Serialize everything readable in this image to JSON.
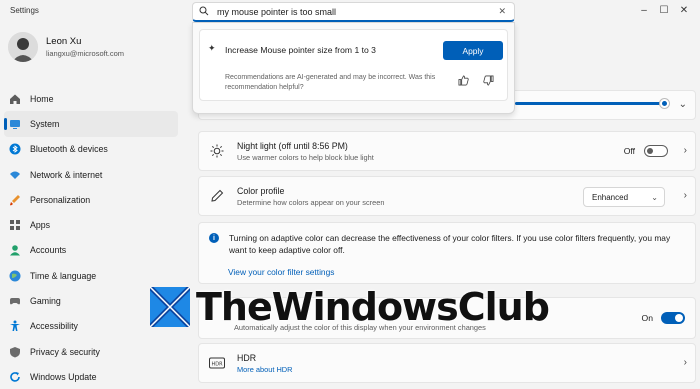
{
  "app": {
    "title": "Settings"
  },
  "profile": {
    "name": "Leon Xu",
    "email": "liangxu@microsoft.com"
  },
  "nav": [
    {
      "label": "Home",
      "icon": "home-icon"
    },
    {
      "label": "System",
      "icon": "system-icon",
      "active": true
    },
    {
      "label": "Bluetooth & devices",
      "icon": "bluetooth-icon"
    },
    {
      "label": "Network & internet",
      "icon": "wifi-icon"
    },
    {
      "label": "Personalization",
      "icon": "brush-icon"
    },
    {
      "label": "Apps",
      "icon": "apps-icon"
    },
    {
      "label": "Accounts",
      "icon": "person-icon"
    },
    {
      "label": "Time & language",
      "icon": "globe-icon"
    },
    {
      "label": "Gaming",
      "icon": "gamepad-icon"
    },
    {
      "label": "Accessibility",
      "icon": "accessibility-icon"
    },
    {
      "label": "Privacy & security",
      "icon": "shield-icon"
    },
    {
      "label": "Windows Update",
      "icon": "update-icon"
    }
  ],
  "search": {
    "value": "my mouse pointer is too small"
  },
  "recommendation": {
    "text": "Increase Mouse pointer size from 1 to 3",
    "apply_label": "Apply",
    "disclaimer": "Recommendations are AI-generated and may be incorrect. Was this recommendation helpful?"
  },
  "night_light": {
    "title": "Night light (off until 8:56 PM)",
    "subtitle": "Use warmer colors to help block blue light",
    "state": "Off"
  },
  "color_profile": {
    "title": "Color profile",
    "subtitle": "Determine how colors appear on your screen",
    "value": "Enhanced"
  },
  "info": {
    "text": "Turning on adaptive color can decrease the effectiveness of your color filters. If you use color filters frequently, you may want to keep adaptive color off.",
    "link": "View your color filter settings"
  },
  "adaptive": {
    "subtitle": "Automatically adjust the color of this display when your environment changes",
    "state": "On"
  },
  "hdr": {
    "title": "HDR",
    "link": "More about HDR"
  },
  "watermark": {
    "text": "TheWindowsClub"
  },
  "colors": {
    "accent": "#005fb8"
  }
}
